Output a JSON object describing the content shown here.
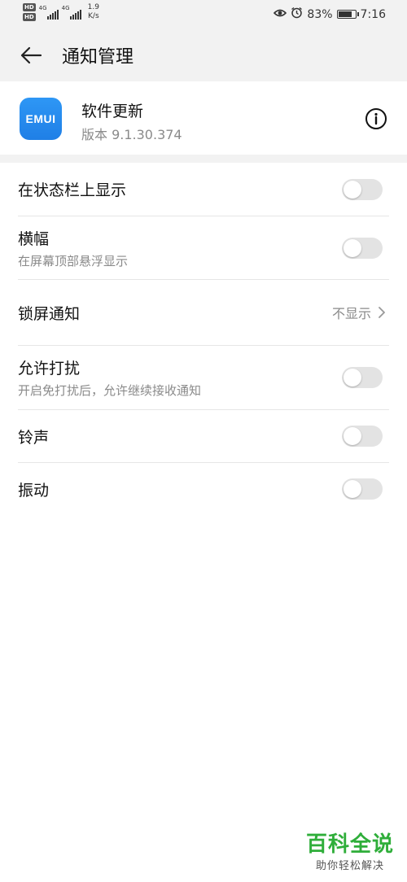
{
  "status_bar": {
    "hd1": "HD",
    "hd2": "HD",
    "net1": "4G",
    "net2": "4G",
    "speed_value": "1.9",
    "speed_unit": "K/s",
    "battery_percent": "83%",
    "battery_level": 0.83,
    "time": "7:16",
    "icons": [
      "eye-comfort-icon",
      "alarm-icon",
      "battery-icon"
    ]
  },
  "header": {
    "title": "通知管理",
    "back_icon": "arrow-left-icon"
  },
  "app": {
    "icon_text": "EMUI",
    "icon_color": "#2e97f5",
    "name": "软件更新",
    "version": "版本 9.1.30.374",
    "info_icon": "info-icon"
  },
  "settings": {
    "status_bar_display": {
      "title": "在状态栏上显示",
      "enabled": false
    },
    "banner": {
      "title": "横幅",
      "subtitle": "在屏幕顶部悬浮显示",
      "enabled": false
    },
    "lock_screen": {
      "title": "锁屏通知",
      "value": "不显示"
    },
    "allow_dnd": {
      "title": "允许打扰",
      "subtitle": "开启免打扰后，允许继续接收通知",
      "enabled": false
    },
    "ringtone": {
      "title": "铃声",
      "enabled": false
    },
    "vibration": {
      "title": "振动",
      "enabled": false
    }
  },
  "watermark": {
    "title": "百科全说",
    "subtitle": "助你轻松解决",
    "color": "#2fae3a"
  }
}
